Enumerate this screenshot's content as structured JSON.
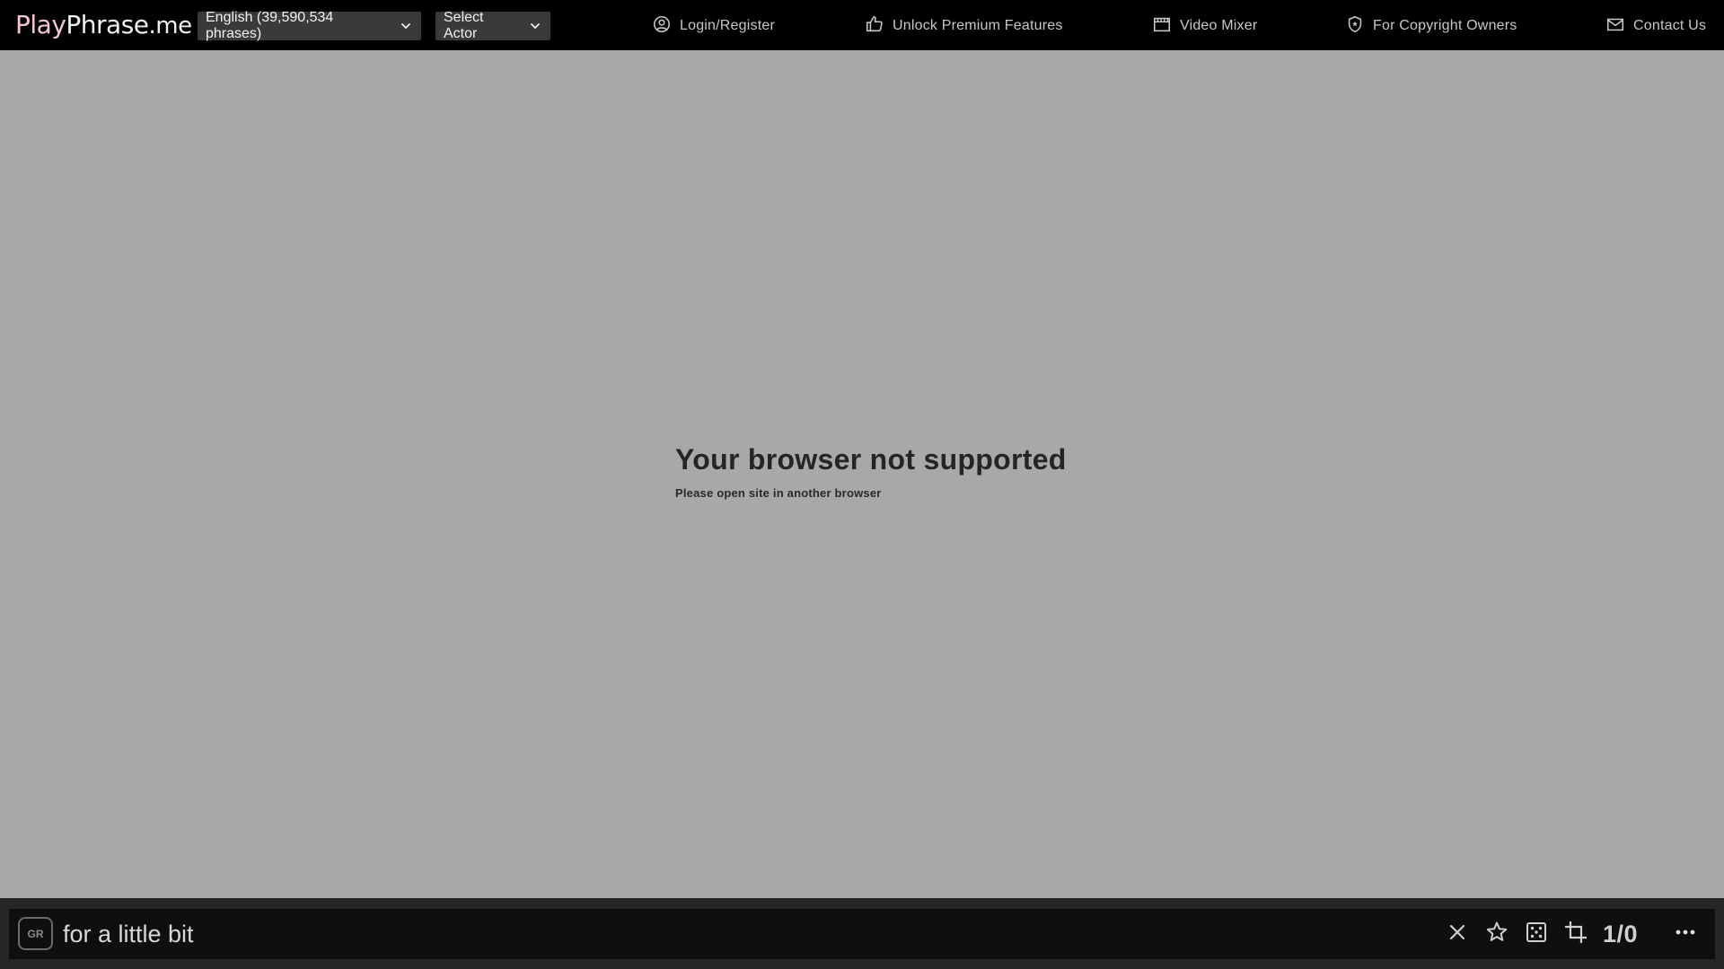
{
  "header": {
    "logo": {
      "part1": "Play",
      "part2": "Phrase",
      "part3": ".me"
    },
    "language_dropdown": {
      "label": "English (39,590,534 phrases)",
      "icon": "chevron-down-icon"
    },
    "actor_dropdown": {
      "label": "Select Actor",
      "icon": "chevron-down-icon"
    },
    "nav": {
      "login": {
        "label": "Login/Register",
        "icon": "user-circle-icon"
      },
      "premium": {
        "label": "Unlock Premium Features",
        "icon": "thumbs-up-icon"
      },
      "mixer": {
        "label": "Video Mixer",
        "icon": "film-icon"
      },
      "copyright": {
        "label": "For Copyright Owners",
        "icon": "shield-icon"
      },
      "contact": {
        "label": "Contact Us",
        "icon": "mail-icon"
      }
    }
  },
  "main": {
    "title": "Your browser not supported",
    "subtitle": "Please open site in another browser"
  },
  "bottom": {
    "badge": "GR",
    "search_value": "for a little bit",
    "counter": "1/0",
    "controls": [
      "close-icon",
      "star-icon",
      "dice-icon",
      "crop-icon",
      "more-icon"
    ]
  },
  "colors": {
    "topbar_bg": "#000000",
    "page_bg": "#a8a8a8",
    "logo_accent": "#f3c6cf",
    "dropdown_bg": "#3a3a3a",
    "bottom_bg": "#0f0f0f"
  }
}
